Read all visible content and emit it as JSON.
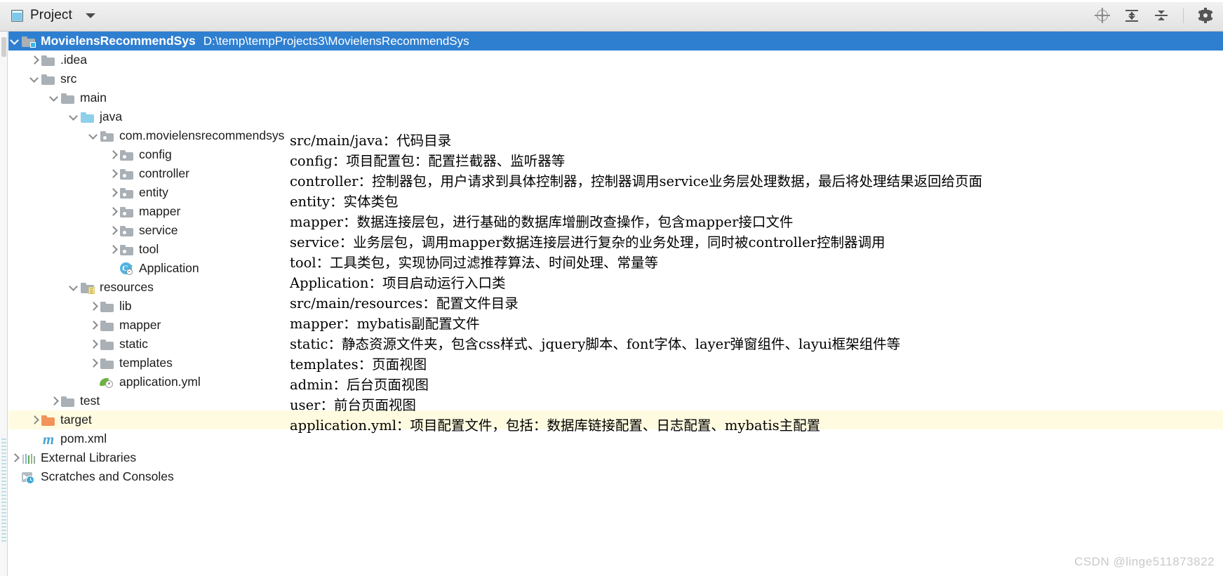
{
  "window": {
    "toolwindow_title": "Project",
    "toolwindow_icon": "project-panel-icon"
  },
  "toolbar": {
    "locate_label": "Select Opened File",
    "expand_label": "Expand All",
    "collapse_label": "Collapse All",
    "settings_label": "Settings"
  },
  "tree": {
    "rows": [
      {
        "label": "MovielensRecommendSys",
        "sub": "D:\\temp\\tempProjects3\\MovielensRecommendSys",
        "indent": 0,
        "arrow": "down",
        "icon": "module-folder-icon",
        "state": "selected"
      },
      {
        "label": ".idea",
        "sub": "",
        "indent": 1,
        "arrow": "right",
        "icon": "folder-icon",
        "state": "normal"
      },
      {
        "label": "src",
        "sub": "",
        "indent": 1,
        "arrow": "down",
        "icon": "folder-icon",
        "state": "normal"
      },
      {
        "label": "main",
        "sub": "",
        "indent": 2,
        "arrow": "down",
        "icon": "folder-icon",
        "state": "normal"
      },
      {
        "label": "java",
        "sub": "",
        "indent": 3,
        "arrow": "down",
        "icon": "source-root-folder-icon",
        "state": "normal"
      },
      {
        "label": "com.movielensrecommendsys",
        "sub": "",
        "indent": 4,
        "arrow": "down",
        "icon": "package-folder-icon",
        "state": "normal"
      },
      {
        "label": "config",
        "sub": "",
        "indent": 5,
        "arrow": "right",
        "icon": "package-folder-icon",
        "state": "normal"
      },
      {
        "label": "controller",
        "sub": "",
        "indent": 5,
        "arrow": "right",
        "icon": "package-folder-icon",
        "state": "normal"
      },
      {
        "label": "entity",
        "sub": "",
        "indent": 5,
        "arrow": "right",
        "icon": "package-folder-icon",
        "state": "normal"
      },
      {
        "label": "mapper",
        "sub": "",
        "indent": 5,
        "arrow": "right",
        "icon": "package-folder-icon",
        "state": "normal"
      },
      {
        "label": "service",
        "sub": "",
        "indent": 5,
        "arrow": "right",
        "icon": "package-folder-icon",
        "state": "normal"
      },
      {
        "label": "tool",
        "sub": "",
        "indent": 5,
        "arrow": "right",
        "icon": "package-folder-icon",
        "state": "normal"
      },
      {
        "label": "Application",
        "sub": "",
        "indent": 5,
        "arrow": "none",
        "icon": "java-class-runnable-icon",
        "state": "normal"
      },
      {
        "label": "resources",
        "sub": "",
        "indent": 3,
        "arrow": "down",
        "icon": "resource-root-folder-icon",
        "state": "normal"
      },
      {
        "label": "lib",
        "sub": "",
        "indent": 4,
        "arrow": "right",
        "icon": "folder-icon",
        "state": "normal"
      },
      {
        "label": "mapper",
        "sub": "",
        "indent": 4,
        "arrow": "right",
        "icon": "folder-icon",
        "state": "normal"
      },
      {
        "label": "static",
        "sub": "",
        "indent": 4,
        "arrow": "right",
        "icon": "folder-icon",
        "state": "normal"
      },
      {
        "label": "templates",
        "sub": "",
        "indent": 4,
        "arrow": "right",
        "icon": "folder-icon",
        "state": "normal"
      },
      {
        "label": "application.yml",
        "sub": "",
        "indent": 4,
        "arrow": "none",
        "icon": "spring-yaml-icon",
        "state": "normal"
      },
      {
        "label": "test",
        "sub": "",
        "indent": 2,
        "arrow": "right",
        "icon": "folder-icon",
        "state": "normal"
      },
      {
        "label": "target",
        "sub": "",
        "indent": 1,
        "arrow": "right",
        "icon": "excluded-folder-icon",
        "state": "highlight"
      },
      {
        "label": "pom.xml",
        "sub": "",
        "indent": 1,
        "arrow": "none",
        "icon": "maven-icon",
        "state": "normal"
      },
      {
        "label": "External Libraries",
        "sub": "",
        "indent": 0,
        "arrow": "right",
        "icon": "external-libraries-icon",
        "state": "normal"
      },
      {
        "label": "Scratches and Consoles",
        "sub": "",
        "indent": 0,
        "arrow": "none",
        "icon": "scratches-consoles-icon",
        "state": "normal"
      }
    ]
  },
  "annotations": {
    "lines": [
      "src/main/java：代码目录",
      "config：项目配置包：配置拦截器、监听器等",
      "controller：控制器包，用户请求到具体控制器，控制器调用service业务层处理数据，最后将处理结果返回给页面",
      "entity：实体类包",
      "mapper：数据连接层包，进行基础的数据库增删改查操作，包含mapper接口文件",
      "service：业务层包，调用mapper数据连接层进行复杂的业务处理，同时被controller控制器调用",
      "tool：工具类包，实现协同过滤推荐算法、时间处理、常量等",
      "Application：项目启动运行入口类",
      "src/main/resources：配置文件目录",
      "mapper：mybatis副配置文件",
      "static：静态资源文件夹，包含css样式、jquery脚本、font字体、layer弹窗组件、layui框架组件等",
      "templates：页面视图",
      "admin：后台页面视图",
      "user：前台页面视图",
      "application.yml：项目配置文件，包括：数据库链接配置、日志配置、mybatis主配置"
    ]
  },
  "watermark": {
    "text": "CSDN @linge511873822"
  },
  "colors": {
    "selection_blue": "#2f7fd1",
    "highlight_yellow": "#fffbe0",
    "source_folder_blue": "#8ecfe9",
    "excluded_folder_orange": "#f2935a",
    "spring_green": "#6db33f",
    "maven_blue": "#4ea3d4"
  }
}
